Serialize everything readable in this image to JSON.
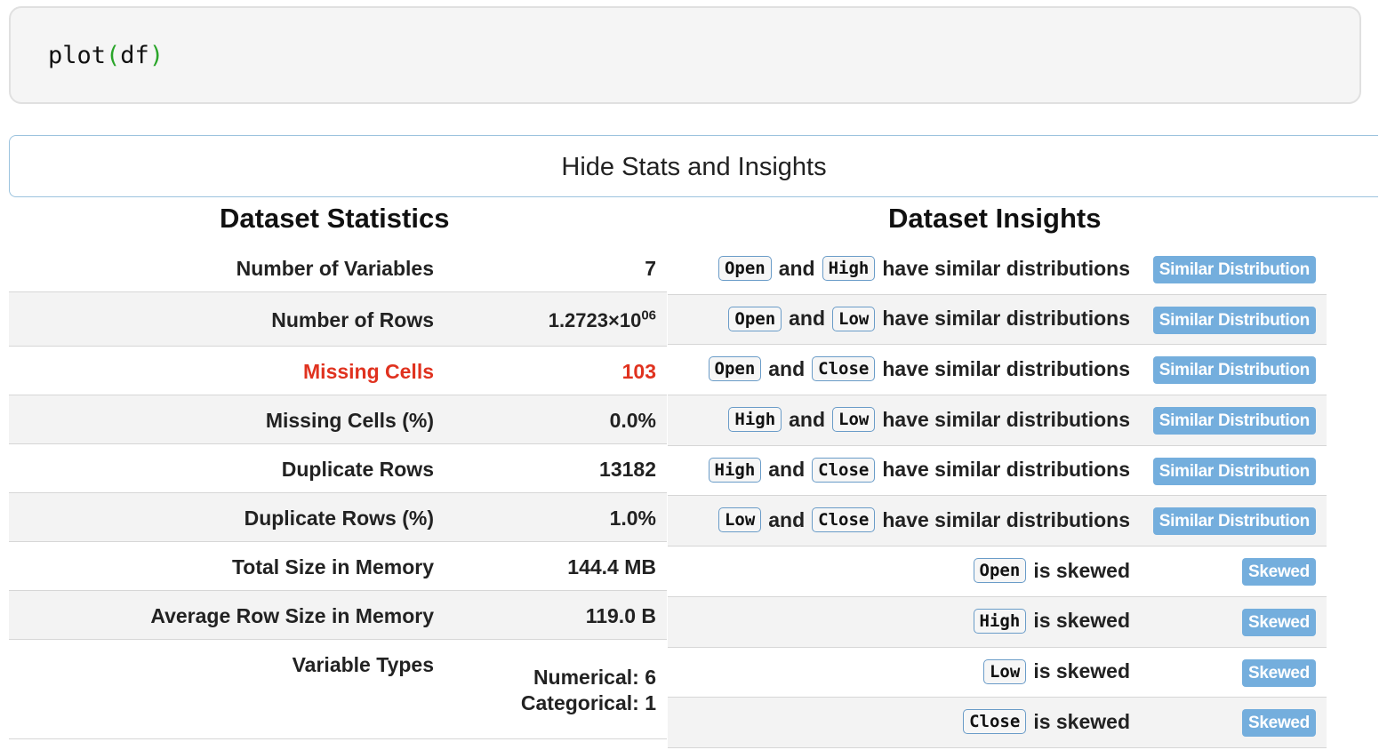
{
  "code_cell": {
    "fn": "plot",
    "open_paren": "(",
    "arg": "df",
    "close_paren": ")"
  },
  "toggle_label": "Hide Stats and Insights",
  "stats": {
    "title": "Dataset Statistics",
    "rows": [
      {
        "label": "Number of Variables",
        "value": "7"
      },
      {
        "label": "Number of Rows",
        "value_mantissa": "1.2723×10",
        "value_exponent": "06"
      },
      {
        "label": "Missing Cells",
        "value": "103"
      },
      {
        "label": "Missing Cells (%)",
        "value": "0.0%"
      },
      {
        "label": "Duplicate Rows",
        "value": "13182"
      },
      {
        "label": "Duplicate Rows (%)",
        "value": "1.0%"
      },
      {
        "label": "Total Size in Memory",
        "value": "144.4 MB"
      },
      {
        "label": "Average Row Size in Memory",
        "value": "119.0 B"
      },
      {
        "label": "Variable Types",
        "value_line1": "Numerical: 6",
        "value_line2": "Categorical: 1"
      }
    ],
    "highlight_color": "#e0321f"
  },
  "insights": {
    "title": "Dataset Insights",
    "connector": "and",
    "similar_text": "have similar distributions",
    "skewed_text": "is skewed",
    "similar_badge": "Similar Distribution",
    "skewed_badge": "Skewed",
    "badge_color": "#74aedd",
    "similar_pairs": [
      [
        "Open",
        "High"
      ],
      [
        "Open",
        "Low"
      ],
      [
        "Open",
        "Close"
      ],
      [
        "High",
        "Low"
      ],
      [
        "High",
        "Close"
      ],
      [
        "Low",
        "Close"
      ]
    ],
    "skewed_columns": [
      "Open",
      "High",
      "Low",
      "Close"
    ]
  }
}
